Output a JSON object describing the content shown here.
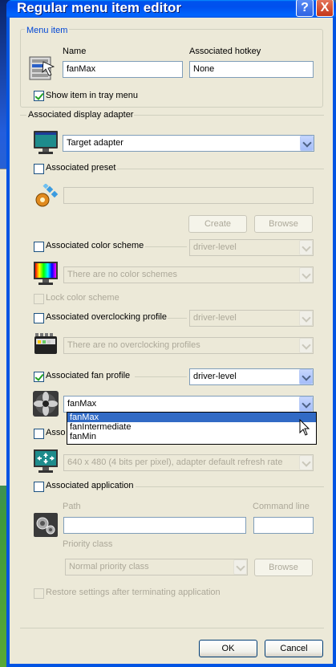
{
  "window": {
    "title": "Regular menu item editor",
    "help_glyph": "?",
    "close_glyph": "X"
  },
  "menu_item": {
    "group_label": "Menu item",
    "name_label": "Name",
    "name_value": "fanMax",
    "hotkey_label": "Associated hotkey",
    "hotkey_value": "None",
    "show_tray_label": "Show item in tray menu",
    "show_tray_checked": true
  },
  "display_adapter": {
    "label": "Associated display adapter",
    "value": "Target adapter"
  },
  "preset": {
    "label": "Associated preset",
    "value": "",
    "create_label": "Create",
    "browse_label": "Browse"
  },
  "color_scheme": {
    "label": "Associated color scheme",
    "level_value": "driver-level",
    "scheme_value": "There are no color schemes",
    "lock_label": "Lock color scheme"
  },
  "overclocking": {
    "label": "Associated overclocking profile",
    "level_value": "driver-level",
    "profile_value": "There are no overclocking profiles"
  },
  "fan_profile": {
    "label": "Associated fan profile",
    "checked": true,
    "level_value": "driver-level",
    "profile_value": "fanMax",
    "options": [
      "fanMax",
      "fanIntermediate",
      "fanMin"
    ]
  },
  "resolution": {
    "label_partial": "Asso",
    "value": "640 x 480 (4 bits per pixel), adapter default refresh rate"
  },
  "application": {
    "label": "Associated application",
    "path_label": "Path",
    "cmd_label": "Command line",
    "priority_label": "Priority class",
    "priority_value": "Normal priority class",
    "browse_label": "Browse",
    "restore_label": "Restore settings after terminating application"
  },
  "footer": {
    "ok_label": "OK",
    "cancel_label": "Cancel"
  },
  "colors": {
    "titlebar": "#0054e3",
    "face": "#ece9d8",
    "selection": "#316ac5",
    "group_title": "#0046d5"
  }
}
